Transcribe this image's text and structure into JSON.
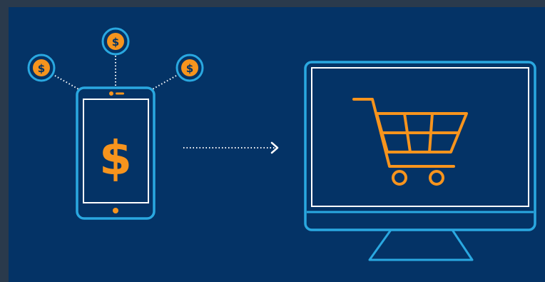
{
  "colors": {
    "outer_frame": "#2a3a4c",
    "background": "#043366",
    "outline_cyan": "#2aa8e0",
    "accent_orange": "#f7941d",
    "screen_white": "#ffffff"
  },
  "icons": {
    "coins": [
      "dollar-coin-icon",
      "dollar-coin-icon",
      "dollar-coin-icon"
    ],
    "phone": "smartphone-icon",
    "arrow": "dotted-arrow-icon",
    "monitor": "desktop-monitor-icon",
    "cart": "shopping-cart-icon"
  },
  "labels": {
    "coin_symbol": "$",
    "phone_screen_symbol": "$"
  }
}
